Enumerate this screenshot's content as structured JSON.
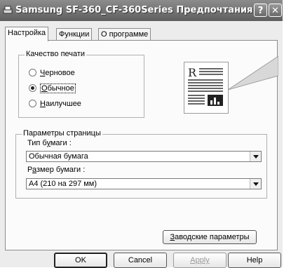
{
  "window": {
    "title": "Samsung SF-360_CF-360Series Предпочтания ...",
    "help_symbol": "?",
    "close_symbol": "✕"
  },
  "tabs": [
    {
      "label": "Настройка",
      "active": true
    },
    {
      "label": "Функции",
      "active": false
    },
    {
      "label": "О программе",
      "active": false
    }
  ],
  "print_quality": {
    "legend": "Качество печати",
    "options": [
      {
        "access_key": "Ч",
        "rest": "ерновое",
        "selected": false
      },
      {
        "access_key": "О",
        "rest": "бычное",
        "selected": true
      },
      {
        "access_key": "Н",
        "rest": "аилучшее",
        "selected": false
      }
    ]
  },
  "preview": {
    "letter": "R"
  },
  "page_params": {
    "legend": "Параметры страницы",
    "paper_type_label_pre": "Тип б",
    "paper_type_label_key": "у",
    "paper_type_label_post": "маги :",
    "paper_type_value": "Обычная бумага",
    "paper_size_label_pre": "Р",
    "paper_size_label_key": "а",
    "paper_size_label_post": "змер бумаги :",
    "paper_size_value": "A4 (210 на 297 мм)"
  },
  "buttons": {
    "defaults_key": "З",
    "defaults_rest": "аводские параметры",
    "ok": "OK",
    "cancel": "Cancel",
    "apply": "Apply",
    "help": "Help"
  }
}
